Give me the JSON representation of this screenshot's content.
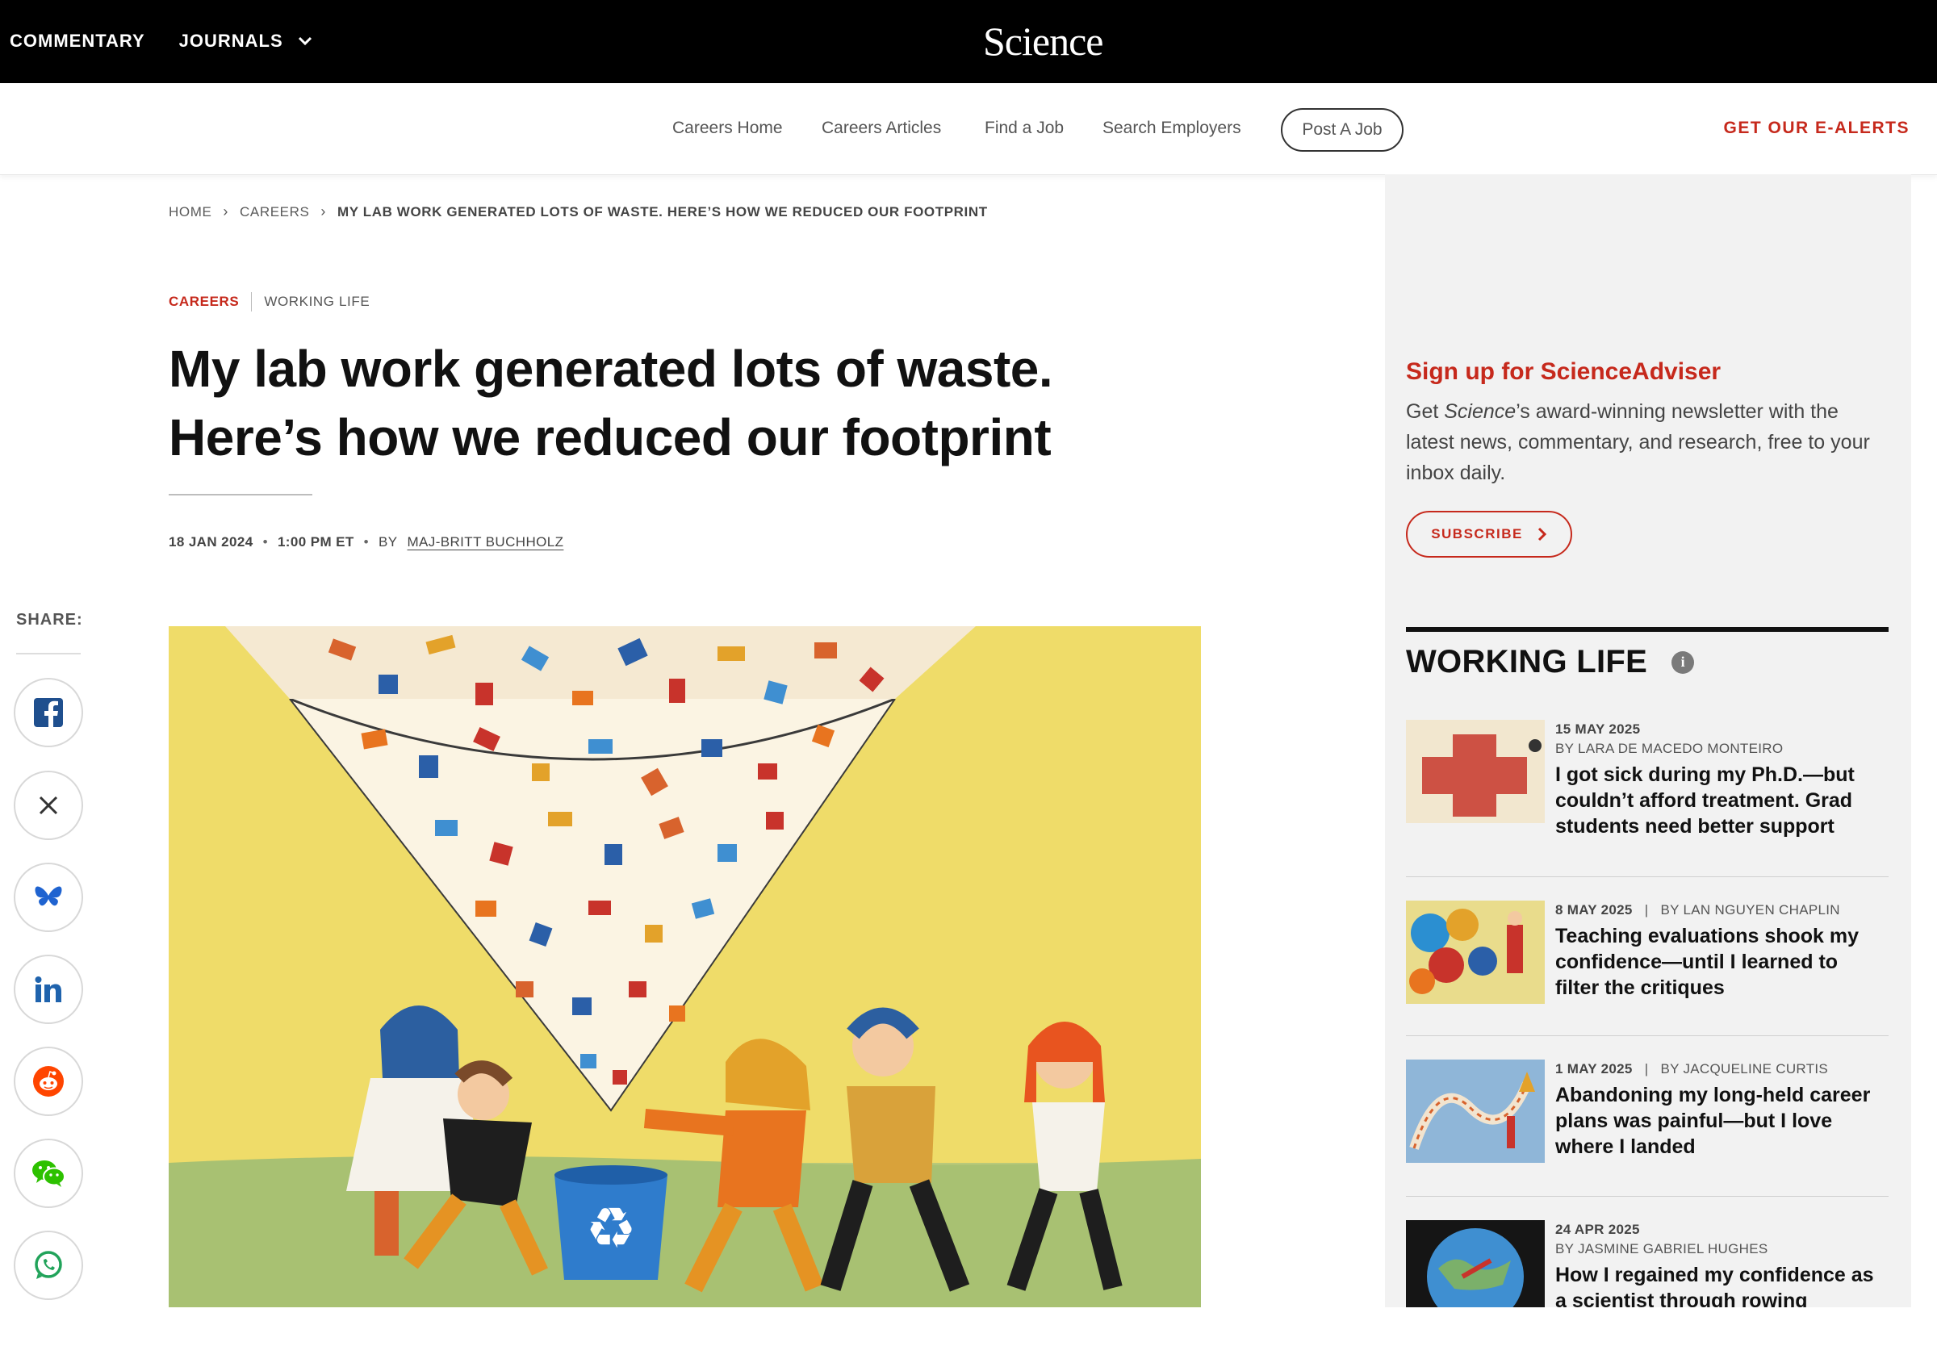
{
  "header": {
    "nav": [
      "COMMENTARY",
      "JOURNALS"
    ],
    "logo": "Science"
  },
  "subnav": {
    "items": [
      "Careers Home",
      "Careers Articles",
      "Find a Job",
      "Search Employers"
    ],
    "post_job": "Post A Job",
    "e_alerts": "GET OUR E-ALERTS"
  },
  "breadcrumb": [
    "HOME",
    "CAREERS",
    "MY LAB WORK GENERATED LOTS OF WASTE. HERE’S HOW WE REDUCED OUR FOOTPRINT"
  ],
  "article": {
    "category": "CAREERS",
    "subcategory": "WORKING LIFE",
    "title_line1": "My lab work generated lots of waste.",
    "title_line2": "Here’s how we reduced our footprint",
    "date": "18 JAN 2024",
    "time": "1:00 PM ET",
    "by": "BY",
    "author": "MAJ-BRITT BUCHHOLZ"
  },
  "share": {
    "label": "SHARE:",
    "icons": [
      "facebook-icon",
      "x-icon",
      "bluesky-icon",
      "linkedin-icon",
      "reddit-icon",
      "wechat-icon",
      "whatsapp-icon"
    ]
  },
  "sidebar": {
    "adviser_title": "Sign up for ScienceAdviser",
    "adviser_desc_pre": "Get ",
    "adviser_desc_em": "Science",
    "adviser_desc_post": "’s award-winning newsletter with the latest news, commentary, and research, free to your inbox daily.",
    "subscribe": "SUBSCRIBE",
    "section_title": "WORKING LIFE",
    "info_glyph": "i",
    "stories": [
      {
        "date": "15 MAY 2025",
        "author": "BY LARA DE MACEDO MONTEIRO",
        "title": "I got sick during my Ph.D.—but couldn’t afford treatment. Grad students need better support"
      },
      {
        "date": "8 MAY 2025",
        "author": "BY LAN NGUYEN CHAPLIN",
        "title": "Teaching evaluations shook my confidence—until I learned to filter the critiques"
      },
      {
        "date": "1 MAY 2025",
        "author": "BY JACQUELINE CURTIS",
        "title": "Abandoning my long-held career plans was painful—but I love where I landed"
      },
      {
        "date": "24 APR 2025",
        "author": "BY JASMINE GABRIEL HUGHES",
        "title": "How I regained my confidence as a scientist through rowing"
      }
    ]
  },
  "colors": {
    "brand_red": "#c6291c",
    "header_bg": "#000000",
    "sidebar_bg": "#f2f2f2"
  }
}
